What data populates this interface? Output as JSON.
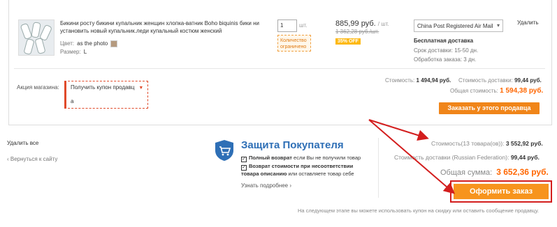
{
  "item": {
    "title": "Бикини росту бикини купальник женщин хлопка-ватник Boho biquinis бики ни установить новый купальник.леди купальный костюм женский",
    "color_label": "Цвет:",
    "color_value": "as the photo",
    "size_label": "Размер:",
    "size_value": "L",
    "qty_value": "1",
    "qty_unit": "шт.",
    "limited_note": "Количество ограничено",
    "price": "885,99 руб.",
    "price_unit": "/ шт.",
    "old_price": "1 362,28 руб./шт.",
    "discount": "35% OFF",
    "shipping_method": "China Post Registered Air Mail",
    "free_shipping": "Бесплатная доставка",
    "delivery_time": "Срок доставки: 15-50 дн.",
    "processing_time": "Обработка заказа: 3 дн.",
    "delete_label": "Удалить"
  },
  "seller_block": {
    "promo_label": "Акция магазина:",
    "coupon_select": "Получить купон продавц",
    "coupon_value": "a",
    "cost_label": "Стоимость:",
    "cost_value": "1 494,94 руб.",
    "shipping_cost_label": "Стоимость доставки:",
    "shipping_cost_value": "99,44 руб.",
    "total_label": "Общая стоимость:",
    "total_value": "1 594,38 руб.",
    "order_button": "Заказать у этого продавца"
  },
  "footer_left": {
    "delete_all": "Удалить все",
    "back_link": "Вернуться к сайту"
  },
  "protection": {
    "title": "Защита Покупателя",
    "line1_bold": "Полный возврат",
    "line1_rest": " если Вы не получили товар",
    "line2_bold": "Возврат стоимости при несоответствии товара описанию",
    "line2_rest": " или оставляете товар себе",
    "learn_more": "Узнать подробнее"
  },
  "summary": {
    "items_label": "Стоимость(13 товара(ов)):",
    "items_value": "3 552,92 руб.",
    "shipping_label": "Стоимость доставки (Russian Federation):",
    "shipping_value": "99,44 руб.",
    "grand_label": "Общая сумма:",
    "grand_value": "3 652,36 руб.",
    "checkout_button": "Оформить заказ"
  },
  "footnote": "На следующем этапе вы можете использовать купон на скидку или оставить сообщение продавцу.",
  "colors": {
    "accent_orange": "#f7941d",
    "price_orange": "#ff6600",
    "annotation_red": "#d31e1e",
    "protection_blue": "#2e6fb6"
  }
}
